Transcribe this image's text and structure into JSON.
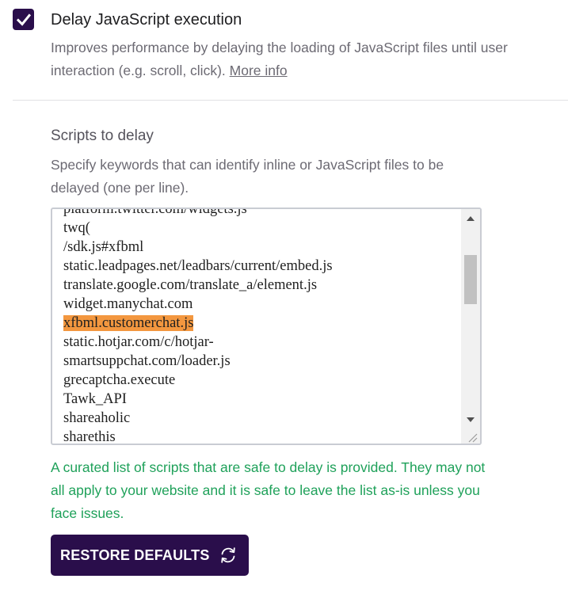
{
  "option": {
    "title": "Delay JavaScript execution",
    "checked": true,
    "description": "Improves performance by delaying the loading of JavaScript files until user interaction (e.g. scroll, click).",
    "more_info_label": "More info"
  },
  "scripts_section": {
    "title": "Scripts to delay",
    "description": "Specify keywords that can identify inline or JavaScript files to be delayed (one per line).",
    "lines": [
      "platform.twitter.com/widgets.js",
      "twq(",
      "/sdk.js#xfbml",
      "static.leadpages.net/leadbars/current/embed.js",
      "translate.google.com/translate_a/element.js",
      "widget.manychat.com",
      "xfbml.customerchat.js",
      "static.hotjar.com/c/hotjar-",
      "smartsuppchat.com/loader.js",
      "grecaptcha.execute",
      "Tawk_API",
      "shareaholic",
      "sharethis"
    ],
    "highlighted_line": "xfbml.customerchat.js",
    "note": "A curated list of scripts that are safe to delay is provided. They may not all apply to your website and it is safe to leave the list as-is unless you face issues."
  },
  "restore_button": {
    "label": "RESTORE DEFAULTS",
    "icon": "refresh-icon"
  },
  "colors": {
    "brand": "#2a0e4b",
    "highlight": "#f3973f",
    "note_green": "#1fa15a"
  }
}
